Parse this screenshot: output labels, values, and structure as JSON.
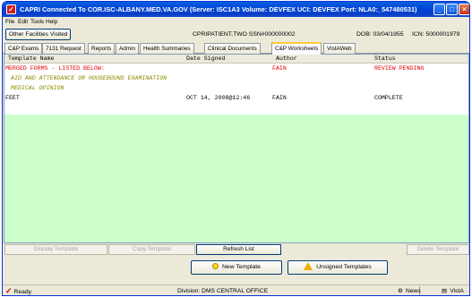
{
  "window": {
    "title": "CAPRI Connected To COR.ISC-ALBANY.MED.VA.GOV (Server: ISC1A3  Volume: DEVFEX  UCI: DEVFEX  Port: NLA0:_547480531)"
  },
  "menu": [
    "File",
    "Edit",
    "Tools",
    "Help"
  ],
  "patient": {
    "other_facilities_button": "Other Facilities Visited",
    "name_ssn": "CPRIPATIENT,TWO  SSN#000000002",
    "dob": "DOB: 03/04/1955",
    "icn": "ICN: 5000001979"
  },
  "tabs": [
    {
      "label": "C&P Exams",
      "active": false
    },
    {
      "label": "7131 Request",
      "active": false
    },
    {
      "label": "Reports",
      "active": false
    },
    {
      "label": "Admin",
      "active": false
    },
    {
      "label": "Health Summaries",
      "active": false
    },
    {
      "label": "Clinical Documents",
      "active": false
    },
    {
      "label": "C&P Worksheets",
      "active": true
    },
    {
      "label": "VistAWeb",
      "active": false
    }
  ],
  "grid": {
    "columns": [
      "Template Name",
      "Date Signed",
      "Author",
      "Status"
    ],
    "rows": [
      {
        "template": "MERGED FORMS - LISTED BELOW:",
        "date": "",
        "author": "FAIN",
        "status": "REVIEW PENDING",
        "style": "red"
      },
      {
        "template": "AID AND ATTENDANCE OR HOUSEBOUND EXAMINATION",
        "date": "",
        "author": "",
        "status": "",
        "style": "olive"
      },
      {
        "template": "MEDICAL OPINION",
        "date": "",
        "author": "",
        "status": "",
        "style": "olive"
      },
      {
        "template": "FEET",
        "date": "OCT 14, 2008@12:46",
        "author": "FAIN",
        "status": "COMPLETE",
        "style": "normal"
      }
    ]
  },
  "buttons": {
    "display_template": "Display Template",
    "copy_template": "Copy Template",
    "refresh_list": "Refresh List",
    "delete_template": "Delete Template",
    "new_template": "New Template",
    "unsigned_templates": "Unsigned Templates"
  },
  "status": {
    "ready": "Ready.",
    "division": "Division: DMS CENTRAL OFFICE",
    "news": "News",
    "vista": "VistA"
  },
  "colors": {
    "title_bar": "#0046d5",
    "worksheet_background": "#ccffcc",
    "pending_text": "#e00000",
    "sub_form_text": "#8a8a00"
  }
}
